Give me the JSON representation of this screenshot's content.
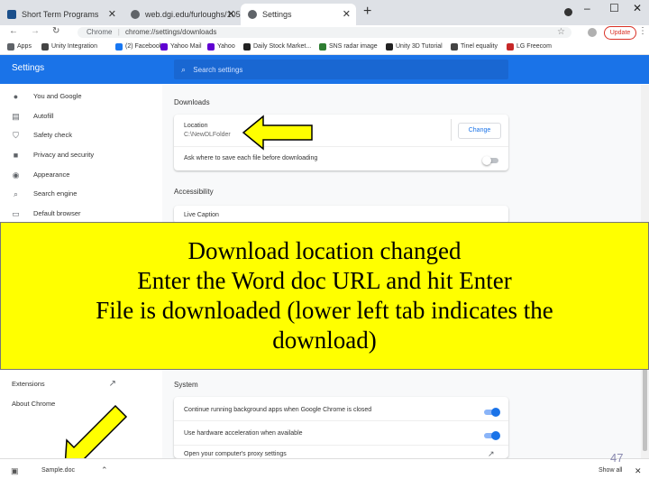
{
  "tabs": [
    {
      "label": "Short Term Programs",
      "color": "#1a4f8b"
    },
    {
      "label": "web.dgi.edu/furloughs/1050/Sh",
      "color": "#5f6368"
    },
    {
      "label": "Settings",
      "color": "#5f6368"
    }
  ],
  "window_controls": {
    "new_tab": "+",
    "minimize": "–",
    "maximize": "☐",
    "close": "✕"
  },
  "toolbar": {
    "back": "←",
    "forward": "→",
    "reload": "↻",
    "url_prefix": "Chrome",
    "url": "chrome://settings/downloads",
    "update_label": "Update"
  },
  "bookmarks": [
    {
      "label": "Apps",
      "color": "#5f6368"
    },
    {
      "label": "Unity Integration",
      "color": "#444444"
    },
    {
      "label": "(2) Facebook",
      "color": "#1877f2"
    },
    {
      "label": "Yahoo Mail",
      "color": "#6001d2"
    },
    {
      "label": "Yahoo",
      "color": "#6001d2"
    },
    {
      "label": "Daily Stock Market...",
      "color": "#222222"
    },
    {
      "label": "SNS radar image",
      "color": "#2e7d32"
    },
    {
      "label": "Unity 3D Tutorial",
      "color": "#222222"
    },
    {
      "label": "Tinel equality",
      "color": "#444444"
    },
    {
      "label": "LG Freecom",
      "color": "#c62828"
    }
  ],
  "settings": {
    "title": "Settings",
    "search_placeholder": "Search settings"
  },
  "nav": [
    {
      "label": "You and Google",
      "icon": "person-icon"
    },
    {
      "label": "Autofill",
      "icon": "clipboard-icon"
    },
    {
      "label": "Safety check",
      "icon": "shield-icon"
    },
    {
      "label": "Privacy and security",
      "icon": "lock-icon"
    },
    {
      "label": "Appearance",
      "icon": "palette-icon"
    },
    {
      "label": "Search engine",
      "icon": "search-icon"
    },
    {
      "label": "Default browser",
      "icon": "browser-icon"
    }
  ],
  "nav_lower": [
    {
      "label": "Extensions",
      "icon": "external-link-icon"
    },
    {
      "label": "About Chrome",
      "icon": ""
    }
  ],
  "downloads": {
    "section_title": "Downloads",
    "location_label": "Location",
    "location_value": "C:\\NewDLFolder",
    "change_button": "Change",
    "ask_label": "Ask where to save each file before downloading",
    "ask_enabled": false
  },
  "accessibility": {
    "section_title": "Accessibility",
    "live_caption": "Live Caption"
  },
  "system": {
    "section_title": "System",
    "rows": [
      {
        "label": "Continue running background apps when Google Chrome is closed",
        "enabled": true
      },
      {
        "label": "Use hardware acceleration when available",
        "enabled": true
      },
      {
        "label": "Open your computer's proxy settings",
        "enabled": null
      }
    ]
  },
  "overlay": {
    "lines": [
      "Download location changed",
      "Enter the Word doc URL and hit Enter",
      "File is downloaded (lower left tab indicates the",
      "download)"
    ]
  },
  "download_shelf": {
    "file_name": "Sample.doc",
    "show_all": "Show all",
    "close": "✕"
  },
  "slide_number": "47",
  "colors": {
    "accent": "#1a73e8",
    "overlay_bg": "#ffff00",
    "arrow_fill": "#ffff00"
  }
}
